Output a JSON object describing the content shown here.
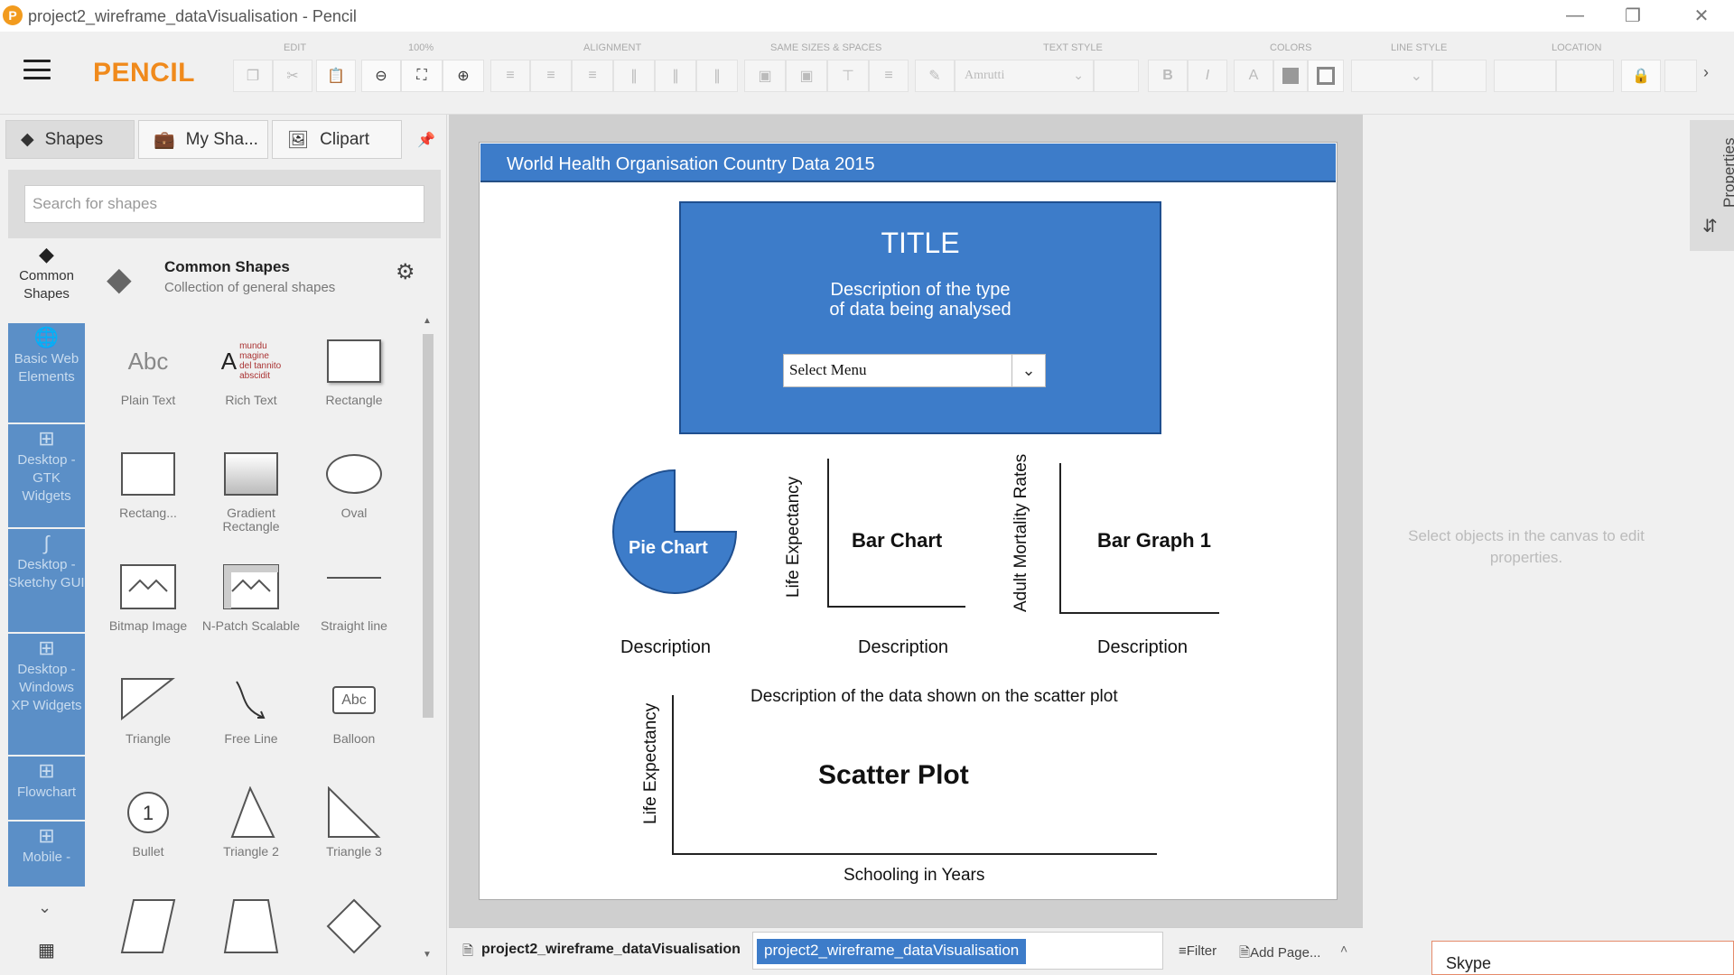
{
  "window": {
    "title": "project2_wireframe_dataVisualisation - Pencil",
    "logo": "P",
    "controls": [
      "minimize",
      "restore",
      "close"
    ]
  },
  "toolbar": {
    "brand": "PENCIL",
    "groups": [
      "EDIT",
      "100%",
      "ALIGNMENT",
      "SAME SIZES & SPACES",
      "TEXT STYLE",
      "COLORS",
      "LINE STYLE",
      "LOCATION"
    ],
    "font_name": "Amrutti"
  },
  "sidebar": {
    "tabs": [
      "Shapes",
      "My Sha...",
      "Clipart"
    ],
    "search_placeholder": "Search for shapes",
    "collections": [
      {
        "label": "Common Shapes",
        "icon": "layers-icon"
      },
      {
        "label": "Basic Web Elements",
        "icon": "globe-icon"
      },
      {
        "label": "Desktop - GTK Widgets",
        "icon": "grid-icon"
      },
      {
        "label": "Desktop - Sketchy GUI",
        "icon": "squiggle-icon"
      },
      {
        "label": "Desktop - Windows XP Widgets",
        "icon": "grid-icon"
      },
      {
        "label": "Flowchart",
        "icon": "grid-icon"
      },
      {
        "label": "Mobile -",
        "icon": "grid-icon"
      }
    ],
    "collection_title": "Common Shapes",
    "collection_subtitle": "Collection of general shapes",
    "shapes": [
      {
        "label": "Plain Text"
      },
      {
        "label": "Rich Text"
      },
      {
        "label": "Rectangle"
      },
      {
        "label": "Rectang..."
      },
      {
        "label": "Gradient Rectangle"
      },
      {
        "label": "Oval"
      },
      {
        "label": "Bitmap Image"
      },
      {
        "label": "N-Patch Scalable"
      },
      {
        "label": "Straight line"
      },
      {
        "label": "Triangle"
      },
      {
        "label": "Free Line"
      },
      {
        "label": "Balloon"
      },
      {
        "label": "Bullet"
      },
      {
        "label": "Triangle 2"
      },
      {
        "label": "Triangle 3"
      }
    ],
    "thumb_text": {
      "plain": "Abc",
      "rich_big": "A",
      "rich_lines": [
        "mundu",
        "magine",
        "del tannito",
        "abscidit"
      ],
      "balloon": "Abc",
      "bullet": "1"
    }
  },
  "canvas": {
    "header": "World Health Organisation Country Data 2015",
    "hero_title": "TITLE",
    "hero_desc_1": "Description of the type",
    "hero_desc_2": "of data being analysed",
    "select_value": "Select Menu",
    "pie_label": "Pie Chart",
    "bar_chart_label": "Bar Chart",
    "bar_chart_ylabel": "Life Expectancy",
    "bar_graph_label": "Bar Graph 1",
    "bar_graph_ylabel": "Adult Mortality Rates",
    "desc": "Description",
    "scatter_desc": "Description of the data shown on the scatter plot",
    "scatter_label": "Scatter Plot",
    "scatter_ylabel": "Life Expectancy",
    "scatter_xlabel": "Schooling in Years"
  },
  "pagebar": {
    "page_name": "project2_wireframe_dataVisualisation",
    "page_name_edit": "project2_wireframe_dataVisualisation",
    "filter": "Filter",
    "add_page": "Add Page..."
  },
  "properties": {
    "tab_label": "Properties",
    "hint": "Select objects in the canvas to edit properties."
  },
  "taskbar": {
    "skype": "Skype"
  },
  "colors": {
    "accent_orange": "#f08a1c",
    "canvas_blue": "#3d7cc9",
    "collection_blue": "#5b8fc7"
  }
}
